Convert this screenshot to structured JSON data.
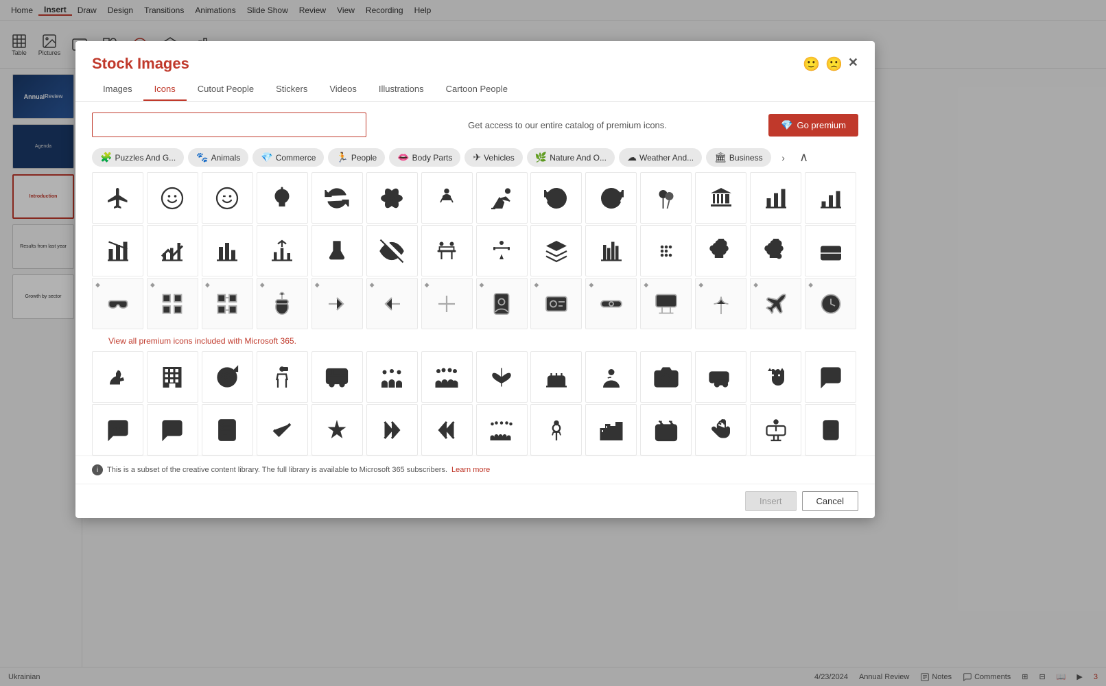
{
  "app": {
    "menu_items": [
      "Home",
      "Insert",
      "Draw",
      "Design",
      "Transitions",
      "Animations",
      "Slide Show",
      "Review",
      "View",
      "Recording",
      "Help"
    ],
    "active_menu": "Insert"
  },
  "modal": {
    "title": "Stock Images",
    "tabs": [
      "Images",
      "Icons",
      "Cutout People",
      "Stickers",
      "Videos",
      "Illustrations",
      "Cartoon People"
    ],
    "active_tab": "Icons",
    "search_placeholder": "",
    "search_hint": "Get access to our entire catalog of premium icons.",
    "go_premium_label": "Go premium",
    "categories": [
      {
        "label": "Puzzles And G...",
        "icon": "🧩"
      },
      {
        "label": "Animals",
        "icon": "🐾"
      },
      {
        "label": "Commerce",
        "icon": "💎"
      },
      {
        "label": "People",
        "icon": "🏃"
      },
      {
        "label": "Body Parts",
        "icon": "👄"
      },
      {
        "label": "Vehicles",
        "icon": "✈"
      },
      {
        "label": "Nature And O...",
        "icon": "🌿"
      },
      {
        "label": "Weather And...",
        "icon": "☁"
      },
      {
        "label": "Business",
        "icon": "🏛"
      }
    ],
    "premium_link_text": "View all premium icons included with Microsoft 365.",
    "info_text": "This is a subset of the creative content library. The full library is available to Microsoft 365 subscribers.",
    "info_link": "Learn more",
    "insert_label": "Insert",
    "cancel_label": "Cancel"
  },
  "status_bar": {
    "language": "Ukrainian",
    "slide_info": "4/23/2024",
    "presentation_name": "Annual Review",
    "notes_label": "Notes",
    "comments_label": "Comments",
    "slide_count": "3"
  }
}
